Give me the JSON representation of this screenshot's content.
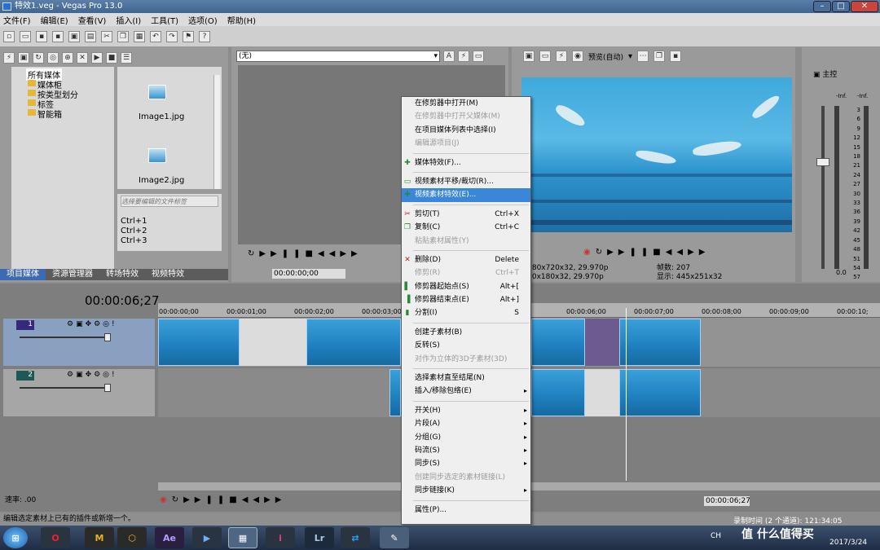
{
  "window": {
    "title": "特效1.veg - Vegas Pro 13.0"
  },
  "menubar": [
    "文件(F)",
    "编辑(E)",
    "查看(V)",
    "插入(I)",
    "工具(T)",
    "选项(O)",
    "帮助(H)"
  ],
  "explorer": {
    "tree": [
      "所有媒体",
      "媒体柜",
      "按类型划分",
      "标签",
      "智能箱"
    ],
    "files": [
      "Image1.jpg",
      "Image2.jpg"
    ],
    "tag_placeholder": "选择要编辑的文件标签",
    "shortcuts": [
      "Ctrl+1",
      "Ctrl+2",
      "Ctrl+3"
    ],
    "tabs": [
      "项目媒体",
      "资源管理器",
      "转场特效",
      "视频特效"
    ]
  },
  "trimmer": {
    "dropdown": "(无)",
    "timecode": "00:00:00;00"
  },
  "preview": {
    "quality": "预览(自动)",
    "project_info": "1280x720x32, 29.970p",
    "preview_info": "320x180x32, 29.970p",
    "frame_label": "帧数:",
    "frame_value": "207",
    "display_label": "显示:",
    "display_value": "445x251x32"
  },
  "mixer": {
    "title": "主控",
    "inf_left": "-Inf.",
    "inf_right": "-Inf.",
    "scale": [
      "3",
      "6",
      "9",
      "12",
      "15",
      "18",
      "21",
      "24",
      "27",
      "30",
      "33",
      "36",
      "39",
      "42",
      "45",
      "48",
      "51",
      "54",
      "57"
    ],
    "zero": "0.0"
  },
  "timeline": {
    "timecode": "00:00:06;27",
    "ruler": [
      "00:00:00;00",
      "00:00:01;00",
      "00:00:02;00",
      "00:00:03;00",
      "00:00:06;00",
      "00:00:07;00",
      "00:00:08;00",
      "00:00:09;00",
      "00:00:10;"
    ],
    "track1_num": "1",
    "track2_num": "2",
    "rate": "速率: .00",
    "bottom_timecode": "00:00:06;27",
    "record_time": "录制时间 (2 个通道): 121:34:05"
  },
  "statusbar": {
    "text": "编辑选定素材上已有的插件或新增一个。"
  },
  "context_menu": [
    {
      "label": "在修剪器中打开(M)",
      "state": "normal"
    },
    {
      "label": "在修剪器中打开父媒体(M)",
      "state": "disabled"
    },
    {
      "label": "在项目媒体列表中选择(I)",
      "state": "normal"
    },
    {
      "label": "编辑源项目(J)",
      "state": "disabled"
    },
    {
      "sep": true
    },
    {
      "label": "媒体特效(F)...",
      "state": "normal",
      "icon": "media-fx"
    },
    {
      "sep": true
    },
    {
      "label": "视频素材平移/裁切(R)...",
      "state": "normal",
      "icon": "pan-crop"
    },
    {
      "label": "视频素材特效(E)...",
      "state": "highlight",
      "icon": "event-fx"
    },
    {
      "sep": true
    },
    {
      "label": "剪切(T)",
      "shortcut": "Ctrl+X",
      "state": "normal",
      "icon": "scissors"
    },
    {
      "label": "复制(C)",
      "shortcut": "Ctrl+C",
      "state": "normal",
      "icon": "copy"
    },
    {
      "label": "粘贴素材属性(Y)",
      "state": "disabled"
    },
    {
      "sep": true
    },
    {
      "label": "删除(D)",
      "shortcut": "Delete",
      "state": "normal",
      "icon": "delete"
    },
    {
      "label": "修剪(R)",
      "shortcut": "Ctrl+T",
      "state": "disabled"
    },
    {
      "label": "修剪器起始点(S)",
      "shortcut": "Alt+[",
      "state": "normal",
      "icon": "trim-start"
    },
    {
      "label": "修剪器结束点(E)",
      "shortcut": "Alt+]",
      "state": "normal",
      "icon": "trim-end"
    },
    {
      "label": "分割(I)",
      "shortcut": "S",
      "state": "normal",
      "icon": "split"
    },
    {
      "sep": true
    },
    {
      "label": "创建子素材(B)",
      "state": "normal"
    },
    {
      "label": "反转(S)",
      "state": "normal"
    },
    {
      "label": "对作为立体的3D子素材(3D)",
      "state": "disabled"
    },
    {
      "sep": true
    },
    {
      "label": "选择素材直至结尾(N)",
      "state": "normal"
    },
    {
      "label": "插入/移除包络(E)",
      "state": "normal",
      "submenu": true
    },
    {
      "sep": true
    },
    {
      "label": "开关(H)",
      "state": "normal",
      "submenu": true
    },
    {
      "label": "片段(A)",
      "state": "normal",
      "submenu": true
    },
    {
      "label": "分组(G)",
      "state": "normal",
      "submenu": true
    },
    {
      "label": "码流(S)",
      "state": "normal",
      "submenu": true
    },
    {
      "label": "同步(S)",
      "state": "normal",
      "submenu": true
    },
    {
      "label": "创建同步选定的素材链接(L)",
      "state": "disabled"
    },
    {
      "label": "同步链接(K)",
      "state": "normal",
      "submenu": true
    },
    {
      "sep": true
    },
    {
      "label": "属性(P)...",
      "state": "normal"
    }
  ],
  "taskbar": {
    "ime": "CH",
    "date": "2017/3/24",
    "watermark": "值 什么值得买"
  },
  "colors": {
    "highlight": "#3a86d8",
    "title": "#3f6590",
    "track_selected": "#8aa0c0"
  }
}
